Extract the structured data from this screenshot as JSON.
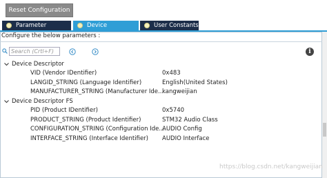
{
  "toolbar": {
    "reset_label": "Reset Configuration"
  },
  "tabs": [
    {
      "label": "Parameter Settings",
      "active": false
    },
    {
      "label": "Device Descriptor",
      "active": true
    },
    {
      "label": "User Constants",
      "active": false
    }
  ],
  "hint": "Configure the below parameters :",
  "search": {
    "placeholder": "Search (Crtl+F)"
  },
  "groups": [
    {
      "label": "Device Descriptor",
      "items": [
        {
          "name": "VID (Vendor IDentifier)",
          "value": "0x483"
        },
        {
          "name": "LANGID_STRING (Language Identifier)",
          "value": "English(United States)"
        },
        {
          "name": "MANUFACTURER_STRING (Manufacturer Ide...",
          "value": "kangweijian"
        }
      ]
    },
    {
      "label": "Device Descriptor FS",
      "items": [
        {
          "name": "PID (Product IDentifier)",
          "value": "0x5740"
        },
        {
          "name": "PRODUCT_STRING (Product Identifier)",
          "value": "STM32 Audio Class"
        },
        {
          "name": "CONFIGURATION_STRING (Configuration Ide...",
          "value": "AUDIO Config"
        },
        {
          "name": "INTERFACE_STRING (Interface Identifier)",
          "value": "AUDIO Interface"
        }
      ]
    }
  ],
  "watermark": "https://blog.csdn.net/kangweijian",
  "colors": {
    "tab_active": "#2f9ed6",
    "tab_inactive": "#1c2e4a",
    "button_gray": "#8a8a8a"
  }
}
